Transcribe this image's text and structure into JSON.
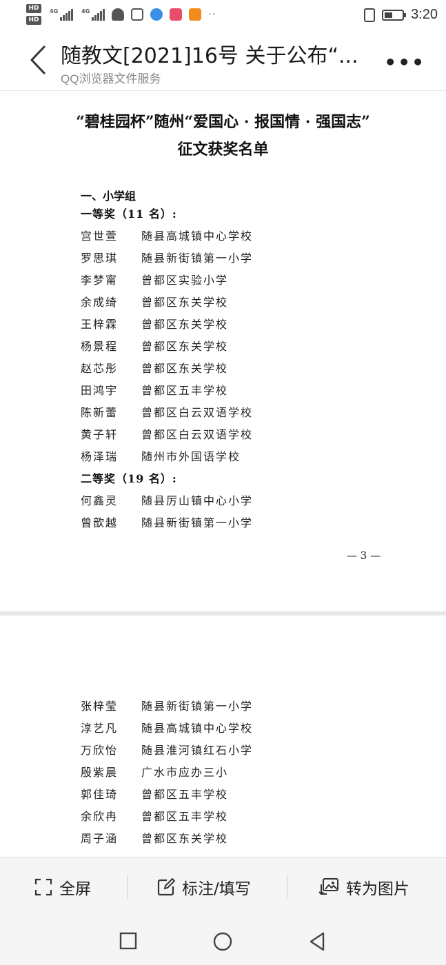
{
  "status_bar": {
    "hd1": "HD",
    "hd2": "HD",
    "net1": "4G",
    "net2": "4G",
    "time": "3:20",
    "battery_level": 0.45
  },
  "header": {
    "title": "随教文[2021]16号 关于公布“...",
    "subtitle": "QQ浏览器文件服务"
  },
  "document": {
    "title_line1": "“碧桂园杯”随州“爱国心 · 报国情 · 强国志”",
    "title_line2": "征文获奖名单",
    "section": "一、小学组",
    "first_prize": "一等奖（11 名）:",
    "first_prize_list": [
      {
        "name": "宫世萱",
        "school": "随县高城镇中心学校"
      },
      {
        "name": "罗思琪",
        "school": "随县新街镇第一小学"
      },
      {
        "name": "李梦甯",
        "school": "曾都区实验小学"
      },
      {
        "name": "余成绮",
        "school": "曾都区东关学校"
      },
      {
        "name": "王梓霖",
        "school": "曾都区东关学校"
      },
      {
        "name": "杨景程",
        "school": "曾都区东关学校"
      },
      {
        "name": "赵芯彤",
        "school": "曾都区东关学校"
      },
      {
        "name": "田鸿宇",
        "school": "曾都区五丰学校"
      },
      {
        "name": "陈新蕾",
        "school": "曾都区白云双语学校"
      },
      {
        "name": "黄子轩",
        "school": "曾都区白云双语学校"
      },
      {
        "name": "杨泽瑞",
        "school": "随州市外国语学校"
      }
    ],
    "second_prize": "二等奖（19 名）:",
    "second_prize_list_p1": [
      {
        "name": "何鑫灵",
        "school": "随县厉山镇中心小学"
      },
      {
        "name": "曾歆越",
        "school": "随县新街镇第一小学"
      }
    ],
    "page_number": "— 3 —",
    "second_prize_list_p2": [
      {
        "name": "张梓莹",
        "school": "随县新街镇第一小学"
      },
      {
        "name": "淳艺凡",
        "school": "随县高城镇中心学校"
      },
      {
        "name": "万欣怡",
        "school": "随县淮河镇红石小学"
      },
      {
        "name": "殷紫晨",
        "school": "广水市应办三小"
      },
      {
        "name": "郭佳琦",
        "school": "曾都区五丰学校"
      },
      {
        "name": "余欣冉",
        "school": "曾都区五丰学校"
      },
      {
        "name": "周子涵",
        "school": "曾都区东关学校"
      }
    ]
  },
  "toolbar": {
    "fullscreen": "全屏",
    "annotate": "标注/填写",
    "to_image": "转为图片"
  }
}
